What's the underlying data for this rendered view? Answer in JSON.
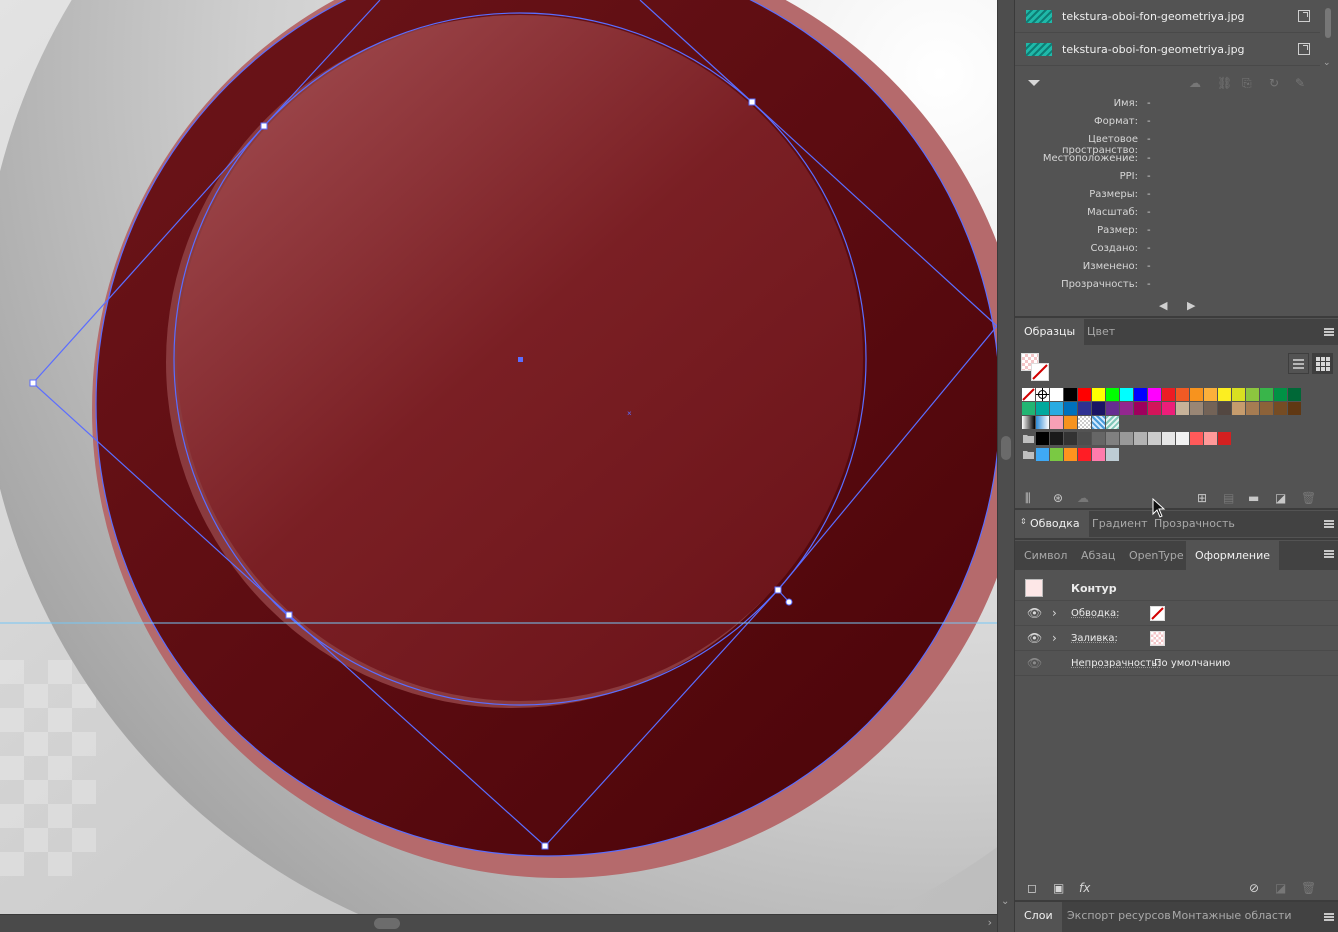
{
  "links": {
    "items": [
      {
        "name": "tekstura-oboi-fon-geometriya.jpg"
      },
      {
        "name": "tekstura-oboi-fon-geometriya.jpg"
      }
    ],
    "info": [
      {
        "label": "Имя:",
        "value": "-"
      },
      {
        "label": "Формат:",
        "value": "-"
      },
      {
        "label": "Цветовое пространство:",
        "value": "-"
      },
      {
        "label": "Местоположение:",
        "value": "-"
      },
      {
        "label": "PPI:",
        "value": "-"
      },
      {
        "label": "Размеры:",
        "value": "-"
      },
      {
        "label": "Масштаб:",
        "value": "-"
      },
      {
        "label": "Размер:",
        "value": "-"
      },
      {
        "label": "Создано:",
        "value": "-"
      },
      {
        "label": "Изменено:",
        "value": "-"
      },
      {
        "label": "Прозрачность:",
        "value": "-"
      }
    ]
  },
  "swatches_panel": {
    "tabs": [
      "Образцы",
      "Цвет"
    ],
    "active_tab": "Образцы",
    "rows": [
      [
        "none",
        "registration",
        "#ffffff",
        "#000000",
        "#ff0000",
        "#ffff00",
        "#00ff00",
        "#00ffff",
        "#0000ff",
        "#ff00ff",
        "#ed1c24",
        "#f15a24",
        "#f7931e",
        "#fbb03b",
        "#fcee21",
        "#d9e021",
        "#8cc63f",
        "#39b54a",
        "#009245",
        "#006837"
      ],
      [
        "#22b573",
        "#00a99d",
        "#29abe2",
        "#0071bc",
        "#2e3192",
        "#1b1464",
        "#662d91",
        "#93278f",
        "#9e005d",
        "#d4145a",
        "#ed1e79",
        "#c7b299",
        "#998675",
        "#736357",
        "#534741",
        "#c69c6d",
        "#a67c52",
        "#8c6239",
        "#754c24",
        "#603813"
      ],
      [
        "grad-bw",
        "grad-blue",
        "#f7a0b6",
        "#f7931e",
        "pattern",
        "pattern-blue",
        "pattern-teal"
      ],
      [
        "folder",
        "#000000",
        "#1a1a1a",
        "#333333",
        "#4d4d4d",
        "#666666",
        "#808080",
        "#999999",
        "#b3b3b3",
        "#cccccc",
        "#e6e6e6",
        "#f2f2f2",
        "#ff5a5a",
        "#ff9999",
        "#d42020"
      ],
      [
        "folder",
        "#3fa9f5",
        "#7ac943",
        "#ff931e",
        "#ff1d25",
        "#ff7bac",
        "#bdccd4"
      ]
    ]
  },
  "stroke_tabs": [
    "Обводка",
    "Градиент",
    "Прозрачность"
  ],
  "type_tabs": [
    "Символ",
    "Абзац",
    "OpenType",
    "Оформление"
  ],
  "appearance": {
    "title": "Контур",
    "rows": [
      {
        "label": "Обводка:",
        "kind": "stroke"
      },
      {
        "label": "Заливка:",
        "kind": "fill"
      }
    ],
    "opacity_label": "Непрозрачность:",
    "opacity_value": "По умолчанию"
  },
  "bottom_tabs": [
    "Слои",
    "Экспорт ресурсов",
    "Монтажные области"
  ],
  "icons": {
    "eye": "eye-icon",
    "chevron": "chevron-right-icon",
    "fx": "fx"
  },
  "colors": {
    "crimson": "#6b0f16",
    "selection": "#5b6dff"
  }
}
